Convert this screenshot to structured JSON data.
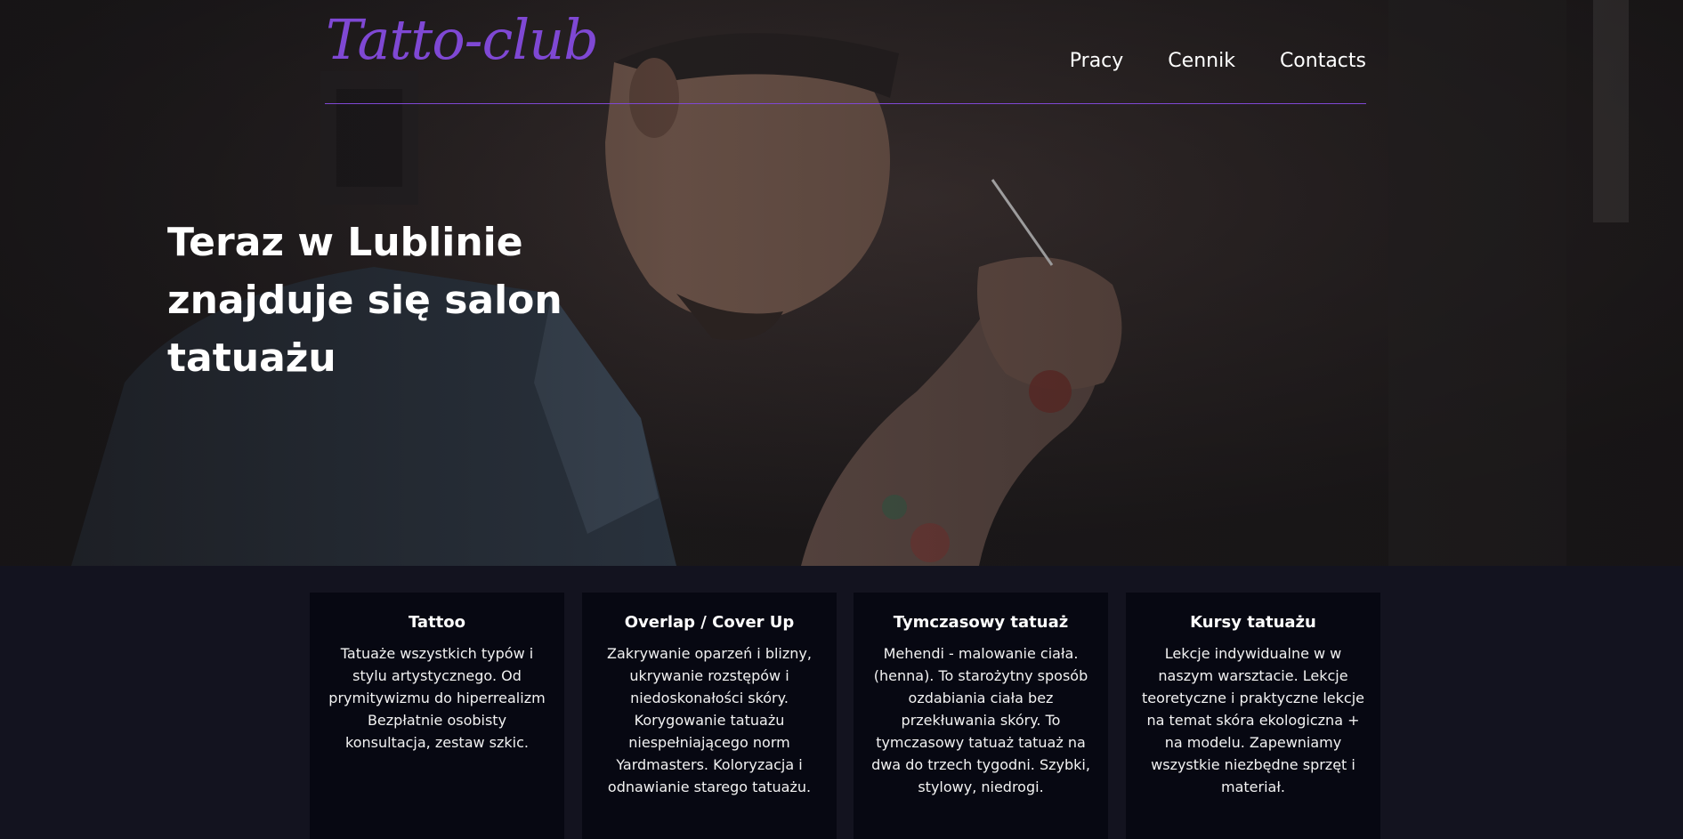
{
  "header": {
    "logo": "Tatto-club",
    "nav": [
      {
        "label": "Pracy"
      },
      {
        "label": "Cennik"
      },
      {
        "label": "Contacts"
      }
    ]
  },
  "hero": {
    "title": "Teraz w Lublinie znajduje się salon tatuażu"
  },
  "services": [
    {
      "title": "Tattoo",
      "text": "Tatuaże wszystkich typów i stylu artystycznego. Od prymitywizmu do hiperrealizm Bezpłatnie osobisty konsultacja, zestaw szkic."
    },
    {
      "title": "Overlap / Cover Up",
      "text": "Zakrywanie oparzeń i blizny, ukrywanie rozstępów i niedoskonałości skóry. Korygowanie tatuażu niespełniającego norm Yardmasters. Koloryzacja i odnawianie starego tatuażu."
    },
    {
      "title": "Tymczasowy tatuaż",
      "text": "Mehendi - malowanie ciała. (henna). To starożytny sposób ozdabiania ciała bez przekłuwania skóry. To tymczasowy tatuaż tatuaż na dwa do trzech tygodni. Szybki, stylowy, niedrogi."
    },
    {
      "title": "Kursy tatuażu",
      "text": "Lekcje indywidualne w w naszym warsztacie. Lekcje teoretyczne i praktyczne lekcje na temat skóra ekologiczna + na modelu. Zapewniamy wszystkie niezbędne sprzęt i materiał."
    }
  ],
  "colors": {
    "accent": "#7f48d4",
    "services_bg": "#13131f",
    "card_bg": "#070812"
  }
}
